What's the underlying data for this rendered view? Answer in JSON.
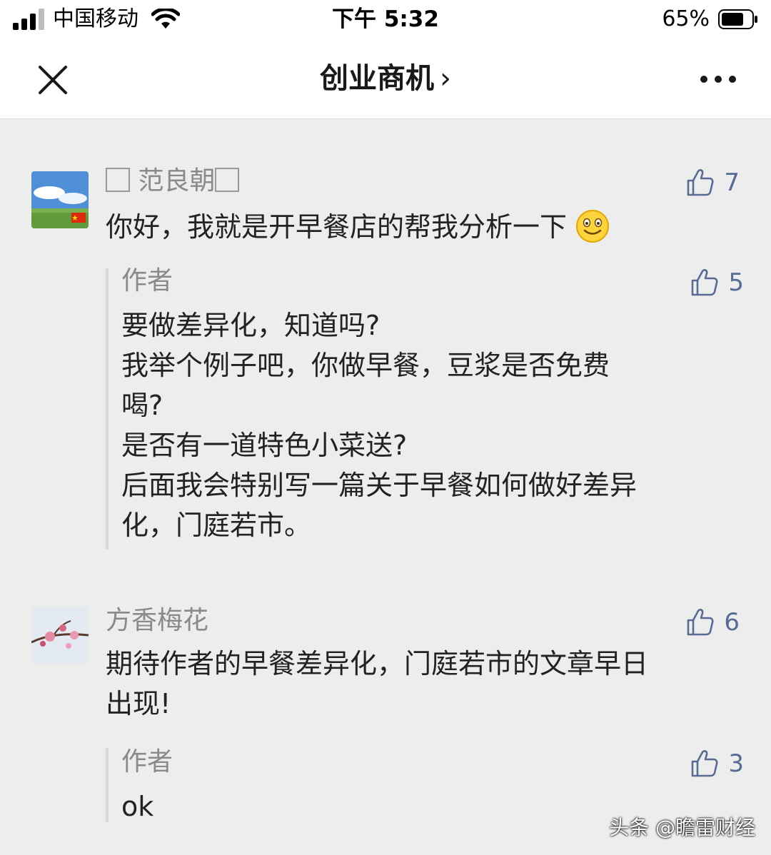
{
  "status_bar": {
    "carrier": "中国移动",
    "time": "下午 5:32",
    "battery": "65%"
  },
  "nav": {
    "title": "创业商机",
    "title_chevron": "›"
  },
  "comments": [
    {
      "username": "范良朝",
      "text": "你好，我就是开早餐店的帮我分析一下",
      "likes": "7",
      "reply": {
        "author": "作者",
        "likes": "5",
        "lines": [
          "要做差异化，知道吗?",
          "我举个例子吧，你做早餐，豆浆是否免费",
          "喝?",
          "是否有一道特色小菜送?",
          "后面我会特别写一篇关于早餐如何做好差异",
          "化，门庭若市。"
        ]
      }
    },
    {
      "username": "方香梅花",
      "text_lines": [
        "期待作者的早餐差异化，门庭若市的文章早日",
        "出现!"
      ],
      "likes": "6",
      "reply": {
        "author": "作者",
        "likes": "3",
        "lines": [
          "ok"
        ]
      }
    }
  ],
  "watermark": "头条 @瞻雷财经",
  "colors": {
    "like_blue": "#576b95",
    "background": "#ededed",
    "username_gray": "#8a8a8a"
  }
}
